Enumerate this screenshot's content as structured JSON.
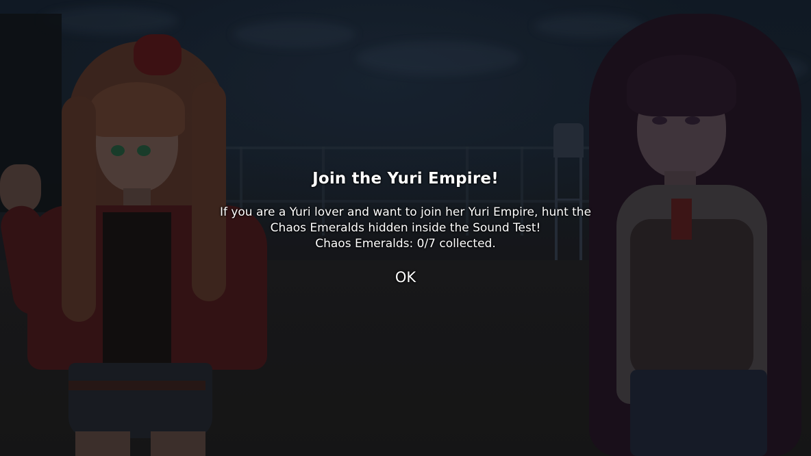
{
  "dialog": {
    "title": "Join the Yuri Empire!",
    "message_lines": [
      "If you are a Yuri lover and want to join her Yuri Empire, hunt the",
      "Chaos Emeralds hidden inside the Sound Test!",
      "Chaos Emeralds: 0/7 collected."
    ],
    "ok_label": "OK"
  },
  "progress": {
    "chaos_emeralds_collected": 0,
    "chaos_emeralds_total": 7
  },
  "colors": {
    "text": "#ffffff",
    "overlay": "#000000",
    "left_character_jacket": "#5a1e22",
    "left_character_hair": "#6b4232",
    "right_character_hair": "#2a1a2c"
  }
}
